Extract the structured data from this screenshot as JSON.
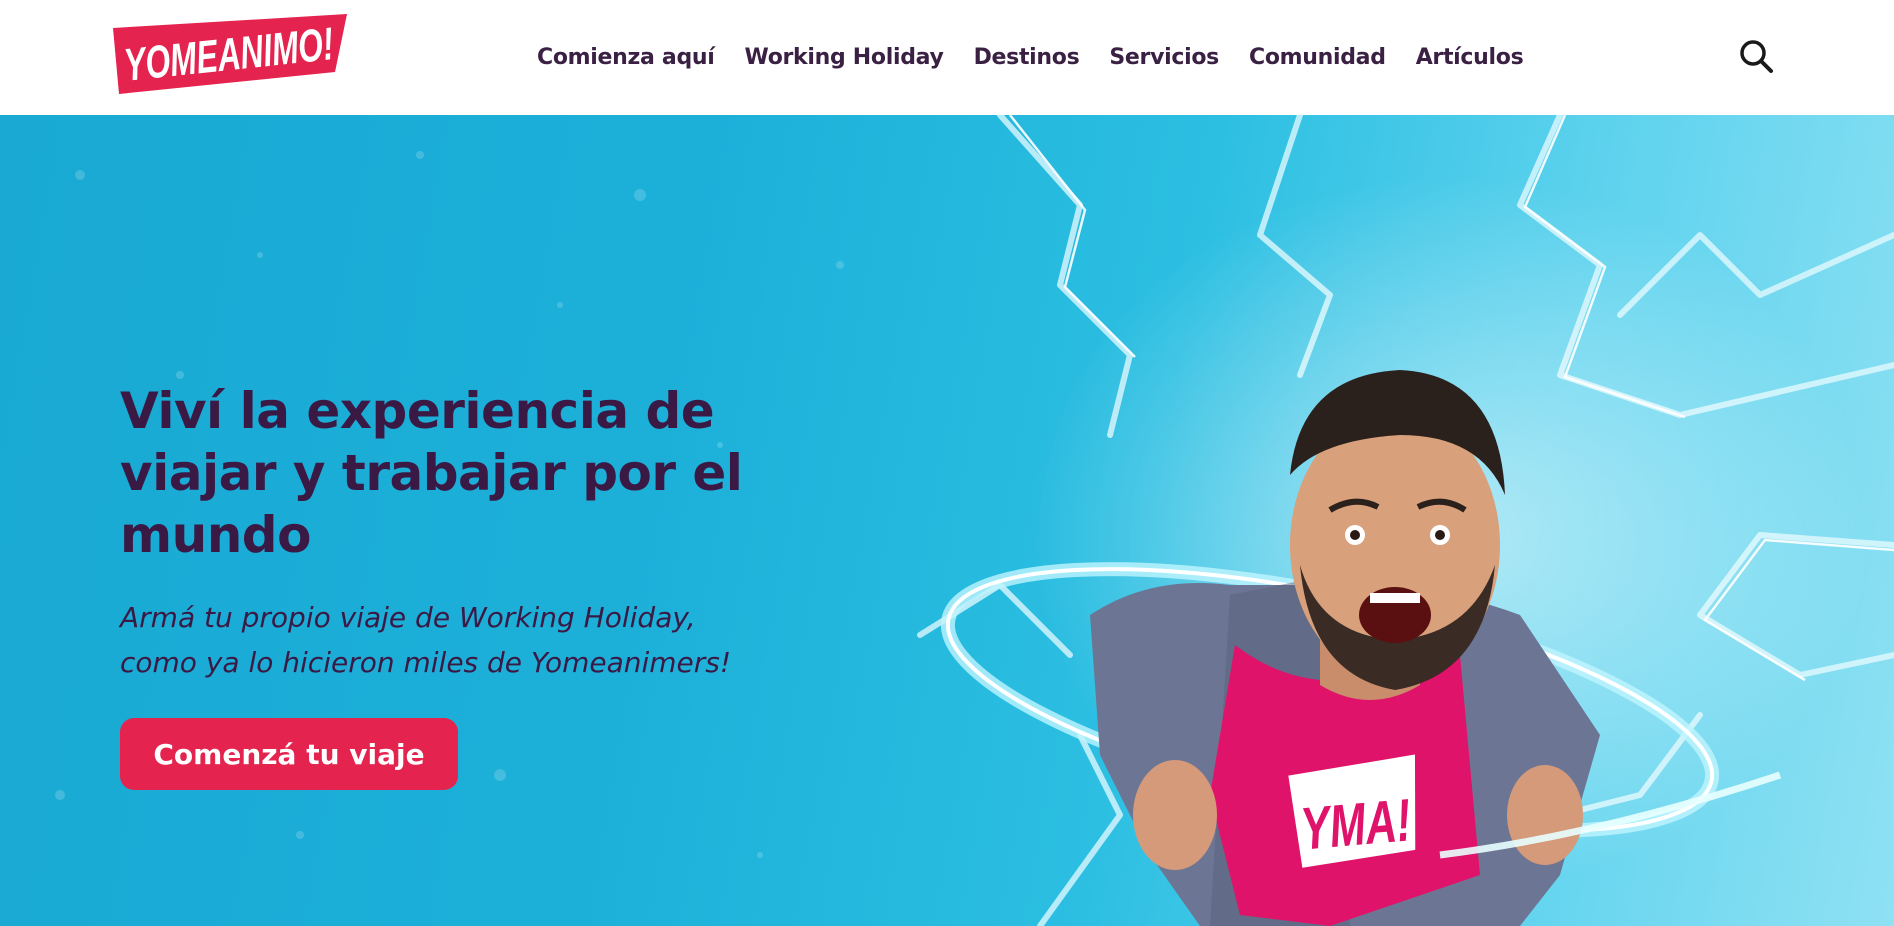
{
  "brand": {
    "logo_text": "YOMEANIMO!",
    "accent_color": "#e4234f",
    "text_color": "#3a1a45"
  },
  "nav": {
    "items": [
      {
        "label": "Comienza aquí"
      },
      {
        "label": "Working Holiday"
      },
      {
        "label": "Destinos"
      },
      {
        "label": "Servicios"
      },
      {
        "label": "Comunidad"
      },
      {
        "label": "Artículos"
      }
    ],
    "search_icon": "search-icon"
  },
  "hero": {
    "title": "Viví la experiencia de viajar y trabajar por el mundo",
    "subtitle_line1": "Armá tu propio viaje de Working Holiday,",
    "subtitle_line2": "como ya lo hicieron miles de Yomeanimers!",
    "cta_label": "Comenzá tu viaje",
    "shirt_logo": "YMA!",
    "background_color": "#1cb0d9"
  }
}
